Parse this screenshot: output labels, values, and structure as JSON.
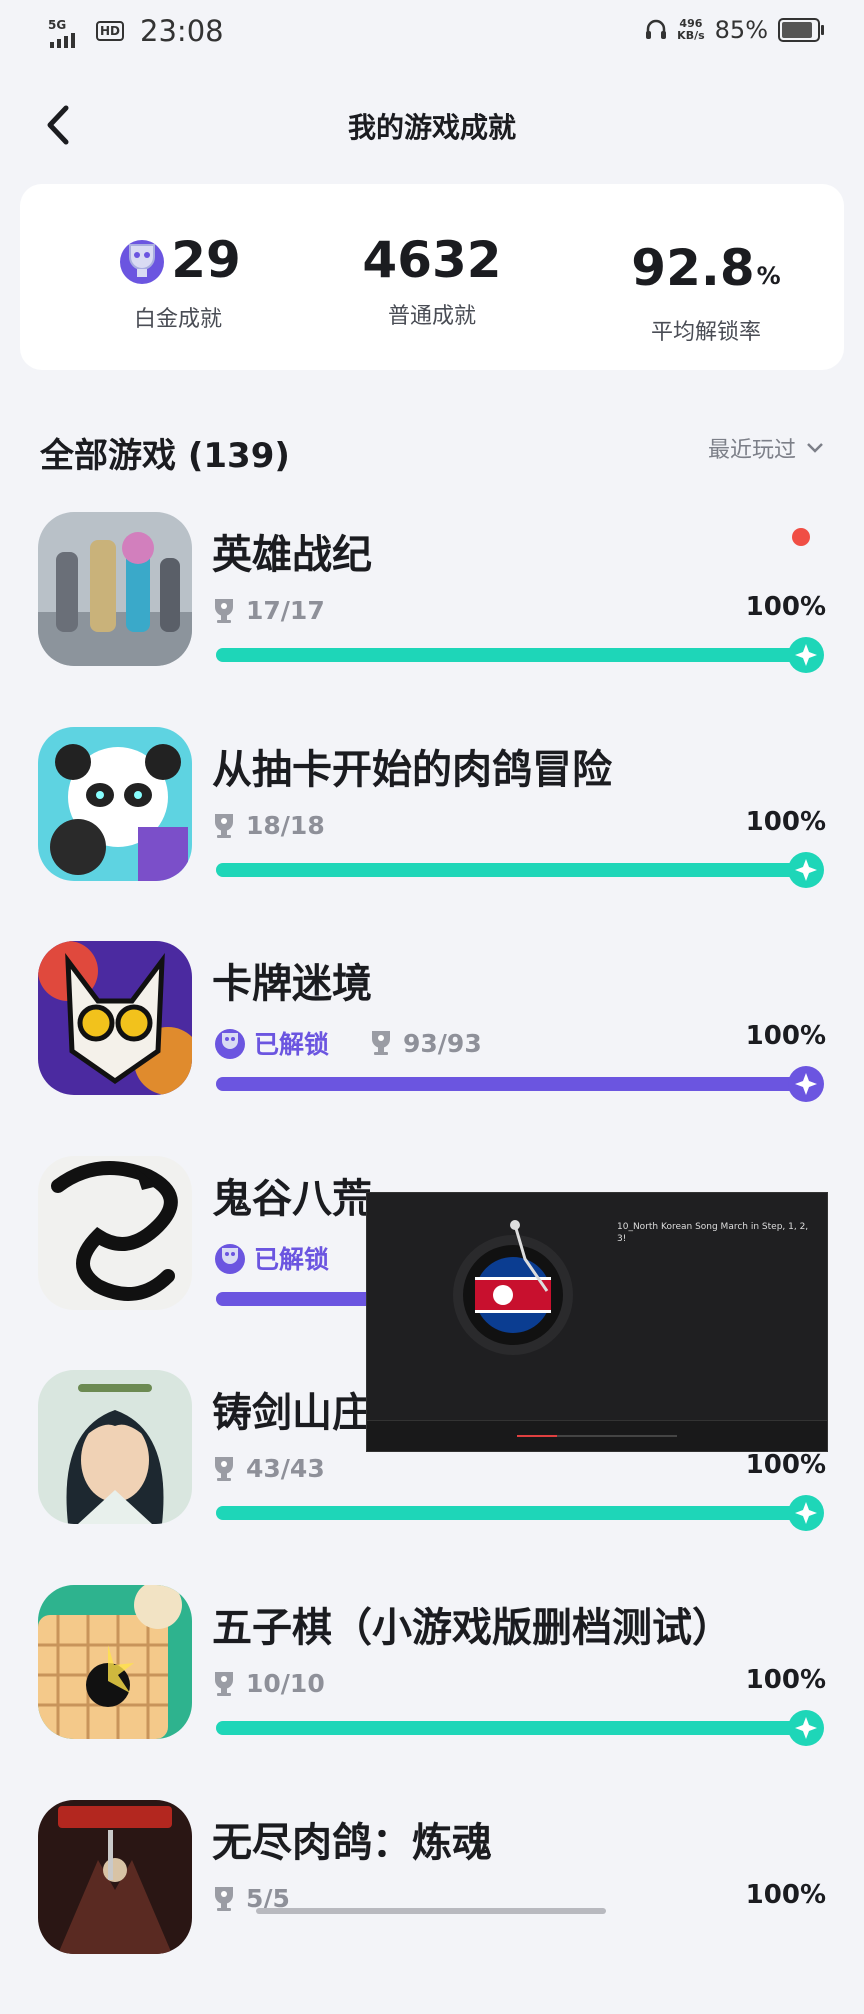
{
  "status_bar": {
    "network": "5G",
    "hd": "HD",
    "time": "23:08",
    "speed_value": "496",
    "speed_unit": "KB/s",
    "battery": "85%"
  },
  "header": {
    "title": "我的游戏成就"
  },
  "summary": {
    "platinum": {
      "value": "29",
      "label": "白金成就"
    },
    "normal": {
      "value": "4632",
      "label": "普通成就"
    },
    "rate": {
      "value": "92.8",
      "unit": "%",
      "label": "平均解锁率"
    }
  },
  "section": {
    "title": "全部游戏 (139)",
    "sort": "最近玩过"
  },
  "games": [
    {
      "name": "英雄战纪",
      "unlocked": "",
      "count": "17/17",
      "percent_text": "100%",
      "progress": 1.0,
      "color": "#1ed6b8",
      "new": true
    },
    {
      "name": "从抽卡开始的肉鸽冒险",
      "unlocked": "",
      "count": "18/18",
      "percent_text": "100%",
      "progress": 1.0,
      "color": "#1ed6b8",
      "new": false
    },
    {
      "name": "卡牌迷境",
      "unlocked": "已解锁",
      "count": "93/93",
      "percent_text": "100%",
      "progress": 1.0,
      "color": "#6b55e0",
      "new": false
    },
    {
      "name": "鬼谷八荒",
      "unlocked": "已解锁",
      "count": "",
      "percent_text": "",
      "progress": 1.0,
      "color": "#6b55e0",
      "new": false
    },
    {
      "name": "铸剑山庄",
      "unlocked": "",
      "count": "43/43",
      "percent_text": "100%",
      "progress": 1.0,
      "color": "#1ed6b8",
      "new": false
    },
    {
      "name": "五子棋（小游戏版删档测试）",
      "unlocked": "",
      "count": "10/10",
      "percent_text": "100%",
      "progress": 1.0,
      "color": "#1ed6b8",
      "new": false
    },
    {
      "name": "无尽肉鸽：炼魂",
      "unlocked": "",
      "count": "5/5",
      "percent_text": "100%",
      "progress": 1.0,
      "color": "#1ed6b8",
      "new": false
    }
  ],
  "pip": {
    "title": "10_North Korean Song March in Step, 1, 2, 3!"
  }
}
